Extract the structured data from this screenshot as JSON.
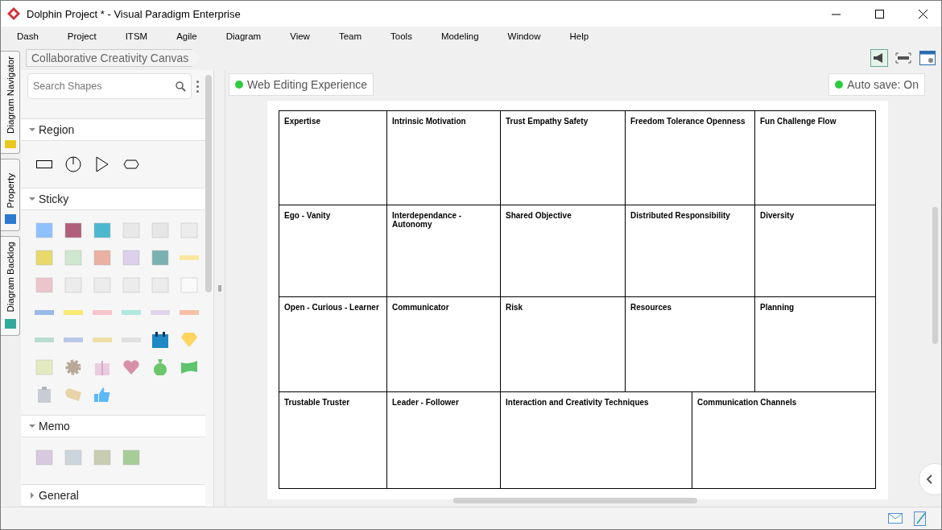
{
  "window": {
    "title": "Dolphin Project * - Visual Paradigm Enterprise"
  },
  "menu": [
    "Dash",
    "Project",
    "ITSM",
    "Agile",
    "Diagram",
    "View",
    "Team",
    "Tools",
    "Modeling",
    "Window",
    "Help"
  ],
  "side_tabs": [
    {
      "label": "Diagram Navigator"
    },
    {
      "label": "Property"
    },
    {
      "label": "Diagram Backlog"
    }
  ],
  "breadcrumb": "Collaborative Creativity Canvas",
  "palette": {
    "search": {
      "placeholder": "Search Shapes"
    },
    "sections": [
      {
        "title": "Region",
        "expanded": true,
        "kind": "region"
      },
      {
        "title": "Sticky",
        "expanded": true,
        "kind": "sticky"
      },
      {
        "title": "Memo",
        "expanded": true,
        "kind": "memo"
      },
      {
        "title": "General",
        "expanded": false
      }
    ]
  },
  "status_chips": [
    {
      "label": "Web Editing Experience",
      "color": "#2ecc40"
    },
    {
      "label": "Auto save: On",
      "color": "#2ecc40"
    }
  ],
  "canvas": {
    "rows": [
      {
        "cells": [
          "Expertise",
          "Intrinsic Motivation",
          "Trust Empathy Safety",
          "Freedom Tolerance Openness",
          "Fun Challenge Flow"
        ]
      },
      {
        "cells": [
          "Ego - Vanity",
          "Interdependance - Autonomy",
          "Shared Objective",
          "Distributed Responsibility",
          "Diversity"
        ]
      },
      {
        "cells": [
          "Open - Curious - Learner",
          "Communicator",
          "Risk",
          "Resources",
          "Planning"
        ]
      },
      {
        "cells": [
          "Trustable Truster",
          "Leader - Follower",
          "Interaction and Creativity Techniques",
          "Communication Channels"
        ]
      }
    ]
  }
}
